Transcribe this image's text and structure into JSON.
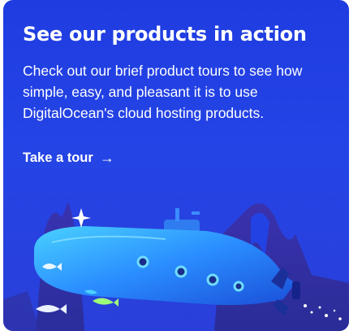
{
  "promo": {
    "title": "See our products in action",
    "description": "Check out our brief product tours to see how simple, easy, and pleasant it is to use DigitalOcean's cloud hosting products.",
    "cta_label": "Take a tour",
    "cta_icon": "arrow-right-icon"
  },
  "colors": {
    "card_bg": "#2242e4",
    "text": "#ffffff",
    "submarine": "#2fa4ff",
    "rock": "#3b2f9e"
  }
}
